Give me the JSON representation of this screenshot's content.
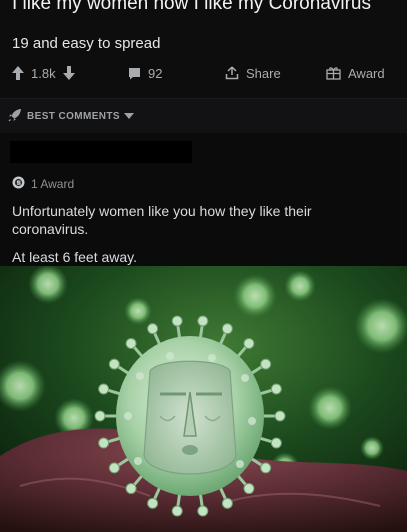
{
  "post": {
    "title": "I like my women how I like my Coronavirus",
    "body": "19 and easy to spread",
    "actions": {
      "upvotes": "1.8k",
      "comments": "92",
      "share": "Share",
      "award": "Award"
    }
  },
  "comments_section": {
    "sort_label": "BEST COMMENTS"
  },
  "comment": {
    "awards": "1 Award",
    "lines": [
      "Unfortunately women like you how they like their",
      "coronavirus.",
      "At least 6 feet away."
    ]
  },
  "colors": {
    "background": "#0b0b0c",
    "text_primary": "#f2f2f2",
    "text_secondary": "#a9acae",
    "virus_green": "#a9d8a8"
  },
  "icons": [
    "upvote-icon",
    "downvote-icon",
    "comment-icon",
    "share-icon",
    "award-icon",
    "rocket-icon",
    "caret-down-icon",
    "silver-award-icon"
  ]
}
